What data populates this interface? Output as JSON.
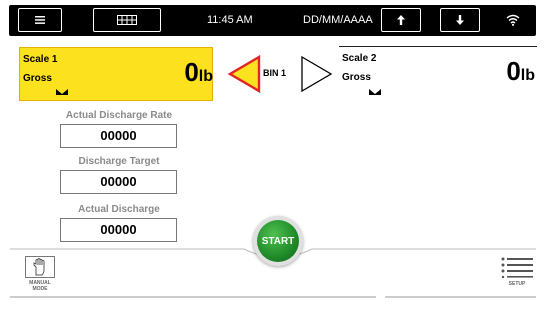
{
  "topbar": {
    "time": "11:45 AM",
    "date_format": "DD/MM/AAAA",
    "icons": [
      "menu-icon",
      "keyboard-icon",
      "arrow-up-icon",
      "arrow-down-icon",
      "wifi-icon"
    ]
  },
  "scale1": {
    "name": "Scale 1",
    "mode": "Gross",
    "value": "0",
    "unit": "lb",
    "selected": true,
    "accent": "#fce11f"
  },
  "scale2": {
    "name": "Scale 2",
    "mode": "Gross",
    "value": "0",
    "unit": "lb",
    "selected": false
  },
  "bin": {
    "label": "BIN 1",
    "left_arrow_color": "#e42323",
    "left_arrow_fill": "#fce11f"
  },
  "fields": [
    {
      "label": "Actual Discharge Rate",
      "value": "00000"
    },
    {
      "label": "Discharge Target",
      "value": "00000"
    },
    {
      "label": "Actual Discharge",
      "value": "00000"
    }
  ],
  "start_button": {
    "label": "START",
    "color": "#1f8a2a"
  },
  "bottom": {
    "manual_mode_label": "MANUAL MODE",
    "setup_label": "SETUP"
  }
}
